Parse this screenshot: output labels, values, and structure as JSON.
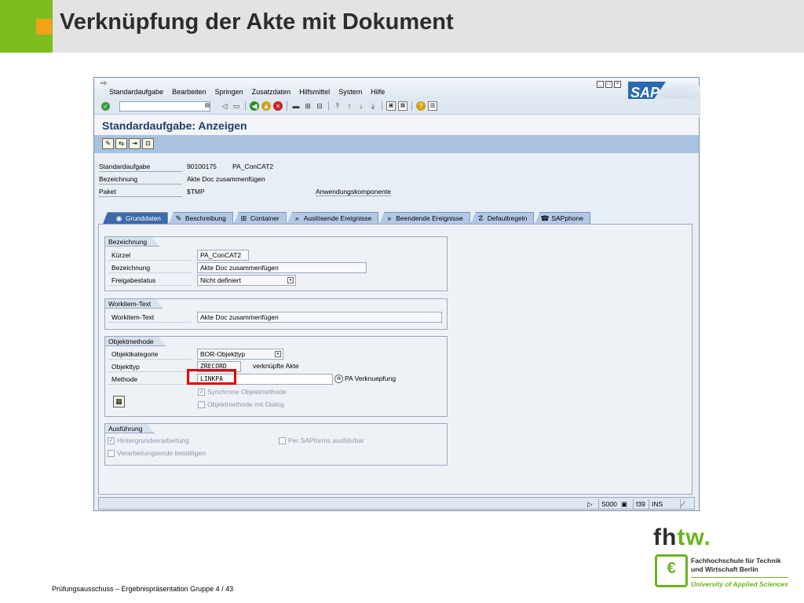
{
  "slide": {
    "title": "Verknüpfung der Akte mit Dokument",
    "footer": "Prüfungsausschuss – Ergebnispräsentation Gruppe 4  /  43",
    "colors": {
      "accent_green": "#7cbd1d",
      "accent_orange": "#f4a11a",
      "header_bg": "#e3e3e3"
    }
  },
  "sap": {
    "menu": [
      "Standardaufgabe",
      "Bearbeiten",
      "Springen",
      "Zusatzdaten",
      "Hilfsmittel",
      "System",
      "Hilfe"
    ],
    "logo_text": "SAP",
    "screen_title": "Standardaufgabe: Anzeigen",
    "header": {
      "standardaufgabe_label": "Standardaufgabe",
      "standardaufgabe_id": "90100175",
      "standardaufgabe_name": "PA_ConCAT2",
      "bezeichnung_label": "Bezeichnung",
      "bezeichnung_value": "Akte Doc zusammenfügen",
      "paket_label": "Paket",
      "paket_value": "$TMP",
      "anwendungskomponente_label": "Anwendungskomponente"
    },
    "tabs": [
      "Grunddaten",
      "Beschreibung",
      "Container",
      "Auslösende Ereignisse",
      "Beendende Ereignisse",
      "Defaultregeln",
      "SAPphone"
    ],
    "groups": {
      "bezeichnung": {
        "title": "Bezeichnung",
        "kuerzel_label": "Kürzel",
        "kuerzel_value": "PA_ConCAT2",
        "bezeichnung_label": "Bezeichnung",
        "bezeichnung_value": "Akte Doc zusammenfügen",
        "freigabe_label": "Freigabestatus",
        "freigabe_value": "Nicht definiert"
      },
      "workitem": {
        "title": "Workitem-Text",
        "label": "Workitem-Text",
        "value": "Akte Doc zusammenfügen"
      },
      "objektmethode": {
        "title": "Objektmethode",
        "kategorie_label": "Objektkategorie",
        "kategorie_value": "BOR-Objekttyp",
        "objekttyp_label": "Objekttyp",
        "objekttyp_value": "ZRECORD",
        "objekttyp_desc": "verknüpfte Akte",
        "methode_label": "Methode",
        "methode_value": "LINKPA",
        "methode_desc": "PA Verknuepfung",
        "synchron_label": "Synchrone Objektmethode",
        "synchron_checked": true,
        "dialog_label": "Objektmethode mit Dialog",
        "dialog_checked": false
      },
      "ausfuehrung": {
        "title": "Ausführung",
        "hintergrund_label": "Hintergrundverarbeitung",
        "hintergrund_checked": true,
        "sapforms_label": "Per SAPforms ausführbar",
        "sapforms_checked": false,
        "ende_label": "Verarbeitungsende bestätigen",
        "ende_checked": false
      }
    },
    "status": {
      "system": "S000",
      "client": "f39",
      "mode": "INS"
    }
  },
  "logo": {
    "line1": "Fachhochschule für Technik",
    "line2": "und Wirtschaft Berlin",
    "line3": "University of Applied Sciences"
  }
}
